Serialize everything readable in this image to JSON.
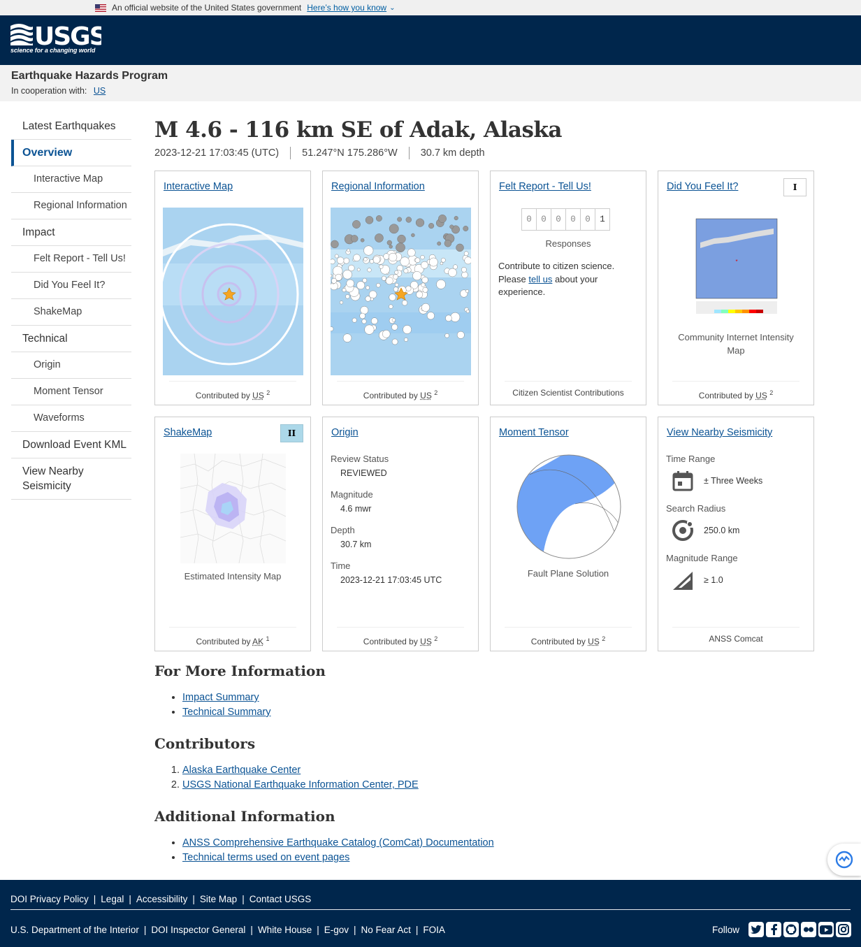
{
  "gov_banner": {
    "text": "An official website of the United States government",
    "link": "Here’s how you know"
  },
  "header": {
    "logo_text": "USGS",
    "logo_tagline": "science for a changing world"
  },
  "program": {
    "title": "Earthquake Hazards Program",
    "coop_label": "In cooperation with:",
    "coop_link": "US"
  },
  "sidebar": {
    "items": [
      {
        "label": "Latest Earthquakes"
      },
      {
        "label": "Overview"
      },
      {
        "label": "Interactive Map"
      },
      {
        "label": "Regional Information"
      },
      {
        "label": "Impact"
      },
      {
        "label": "Felt Report - Tell Us!"
      },
      {
        "label": "Did You Feel It?"
      },
      {
        "label": "ShakeMap"
      },
      {
        "label": "Technical"
      },
      {
        "label": "Origin"
      },
      {
        "label": "Moment Tensor"
      },
      {
        "label": "Waveforms"
      },
      {
        "label": "Download Event KML"
      },
      {
        "label": "View Nearby Seismicity"
      }
    ]
  },
  "event": {
    "title": "M 4.6 - 116 km SE of Adak, Alaska",
    "time": "2023-12-21 17:03:45 (UTC)",
    "location": "51.247°N 175.286°W",
    "depth": "30.7 km depth"
  },
  "cards": {
    "interactive_map": {
      "title": "Interactive Map",
      "contrib": "Contributed by",
      "net": "US",
      "sup": "2"
    },
    "regional": {
      "title": "Regional Information",
      "contrib": "Contributed by",
      "net": "US",
      "sup": "2"
    },
    "felt": {
      "title": "Felt Report - Tell Us!",
      "digits": [
        "0",
        "0",
        "0",
        "0",
        "0",
        "1"
      ],
      "responses": "Responses",
      "text_before": "Contribute to citizen science. Please ",
      "link": "tell us",
      "text_after": " about your experience.",
      "footer": "Citizen Scientist Contributions"
    },
    "dyfi": {
      "title": "Did You Feel It?",
      "badge": "I",
      "caption": "Community Internet Intensity Map",
      "contrib": "Contributed by",
      "net": "US",
      "sup": "2"
    },
    "shakemap": {
      "title": "ShakeMap",
      "badge": "II",
      "caption": "Estimated Intensity Map",
      "contrib": "Contributed by",
      "net": "AK",
      "sup": "1"
    },
    "origin": {
      "title": "Origin",
      "fields": [
        {
          "label": "Review Status",
          "value": "REVIEWED"
        },
        {
          "label": "Magnitude",
          "value": "4.6 mwr"
        },
        {
          "label": "Depth",
          "value": "30.7 km"
        },
        {
          "label": "Time",
          "value": "2023-12-21 17:03:45 UTC"
        }
      ],
      "contrib": "Contributed by",
      "net": "US",
      "sup": "2"
    },
    "moment_tensor": {
      "title": "Moment Tensor",
      "caption": "Fault Plane Solution",
      "contrib": "Contributed by",
      "net": "US",
      "sup": "2"
    },
    "nearby": {
      "title": "View Nearby Seismicity",
      "time_label": "Time Range",
      "time_value": "± Three Weeks",
      "radius_label": "Search Radius",
      "radius_value": "250.0 km",
      "mag_label": "Magnitude Range",
      "mag_value": "≥ 1.0",
      "footer": "ANSS Comcat"
    }
  },
  "more_info": {
    "heading": "For More Information",
    "links": [
      "Impact Summary",
      "Technical Summary"
    ]
  },
  "contributors": {
    "heading": "Contributors",
    "links": [
      "Alaska Earthquake Center",
      "USGS National Earthquake Information Center, PDE"
    ]
  },
  "additional": {
    "heading": "Additional Information",
    "links": [
      "ANSS Comprehensive Earthquake Catalog (ComCat) Documentation",
      "Technical terms used on event pages"
    ]
  },
  "footer": {
    "row1": [
      "DOI Privacy Policy",
      "Legal",
      "Accessibility",
      "Site Map",
      "Contact USGS"
    ],
    "row2": [
      "U.S. Department of the Interior",
      "DOI Inspector General",
      "White House",
      "E-gov",
      "No Fear Act",
      "FOIA"
    ],
    "follow": "Follow"
  },
  "colors": {
    "header_bg": "#00264c",
    "link": "#0b5394",
    "shakemap_badge": "#acd8e9"
  }
}
